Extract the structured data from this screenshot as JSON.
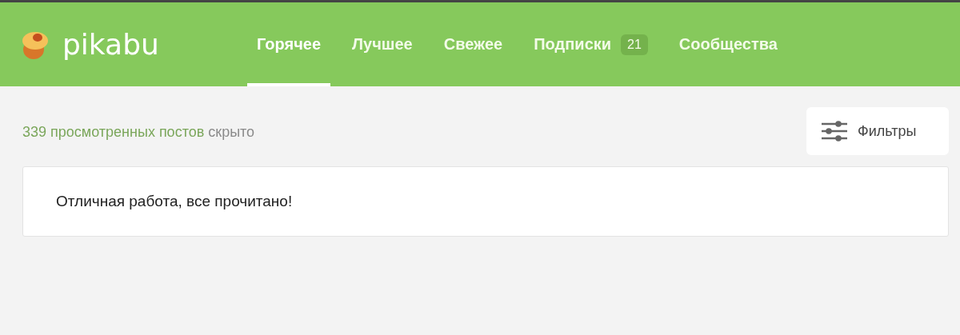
{
  "header": {
    "logo_text": "pikabu",
    "tabs": [
      {
        "label": "Горячее",
        "selected": true
      },
      {
        "label": "Лучшее",
        "selected": false
      },
      {
        "label": "Свежее",
        "selected": false
      },
      {
        "label": "Подписки",
        "selected": false,
        "badge": "21"
      },
      {
        "label": "Сообщества",
        "selected": false
      }
    ]
  },
  "hidden_notice": {
    "link": "339 просмотренных постов",
    "text": "скрыто"
  },
  "filters_button": {
    "label": "Фильтры"
  },
  "message": "Отличная работа, все прочитано!"
}
